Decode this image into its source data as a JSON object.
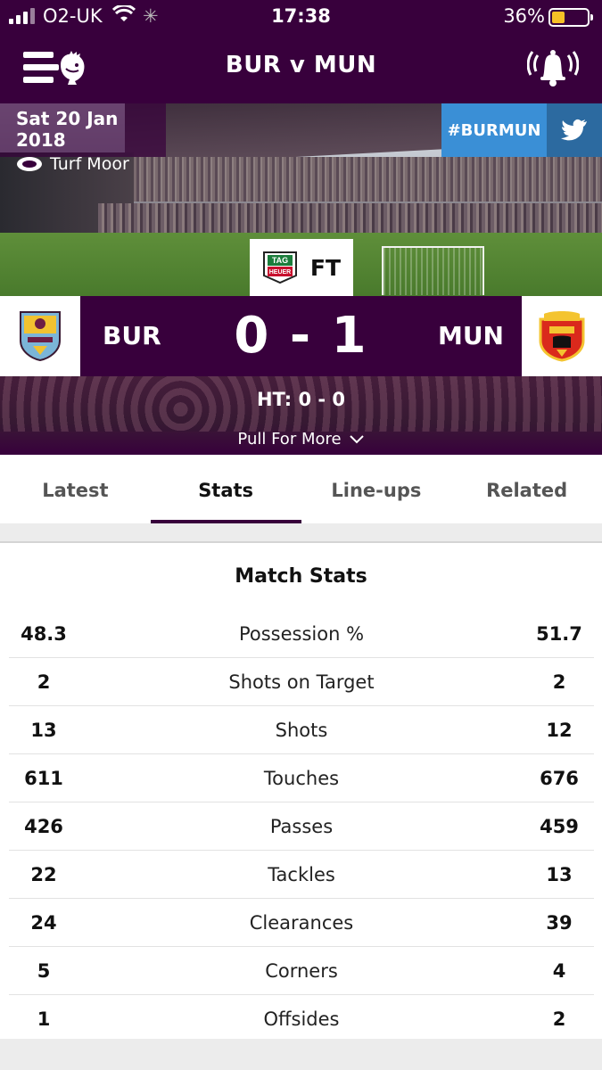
{
  "status_bar": {
    "carrier": "O2-UK",
    "time": "17:38",
    "battery_percent": "36%",
    "battery_level": 0.36
  },
  "header": {
    "title": "BUR v MUN"
  },
  "match": {
    "date": "Sat 20 Jan 2018",
    "venue": "Turf Moor",
    "hashtag": "#BURMUN",
    "status": "FT",
    "home_code": "BUR",
    "away_code": "MUN",
    "score": "0 - 1",
    "half_time": "HT: 0 - 0",
    "pull_label": "Pull For More"
  },
  "tabs": [
    {
      "label": "Latest",
      "active": false
    },
    {
      "label": "Stats",
      "active": true
    },
    {
      "label": "Line-ups",
      "active": false
    },
    {
      "label": "Related",
      "active": false
    }
  ],
  "stats": {
    "title": "Match Stats",
    "rows": [
      {
        "home": "48.3",
        "label": "Possession %",
        "away": "51.7"
      },
      {
        "home": "2",
        "label": "Shots on Target",
        "away": "2"
      },
      {
        "home": "13",
        "label": "Shots",
        "away": "12"
      },
      {
        "home": "611",
        "label": "Touches",
        "away": "676"
      },
      {
        "home": "426",
        "label": "Passes",
        "away": "459"
      },
      {
        "home": "22",
        "label": "Tackles",
        "away": "13"
      },
      {
        "home": "24",
        "label": "Clearances",
        "away": "39"
      },
      {
        "home": "5",
        "label": "Corners",
        "away": "4"
      },
      {
        "home": "1",
        "label": "Offsides",
        "away": "2"
      }
    ]
  },
  "colors": {
    "brand_purple": "#38003c",
    "twitter_blue": "#3a8fd6",
    "battery_yellow": "#f6c026"
  },
  "icons": [
    "signal-icon",
    "wifi-icon",
    "spinner-icon",
    "battery-icon",
    "menu-icon",
    "premier-league-lion-icon",
    "bell-icon",
    "stadium-icon",
    "twitter-icon",
    "tag-heuer-logo",
    "burnley-crest",
    "man-united-crest",
    "chevron-down-icon"
  ]
}
